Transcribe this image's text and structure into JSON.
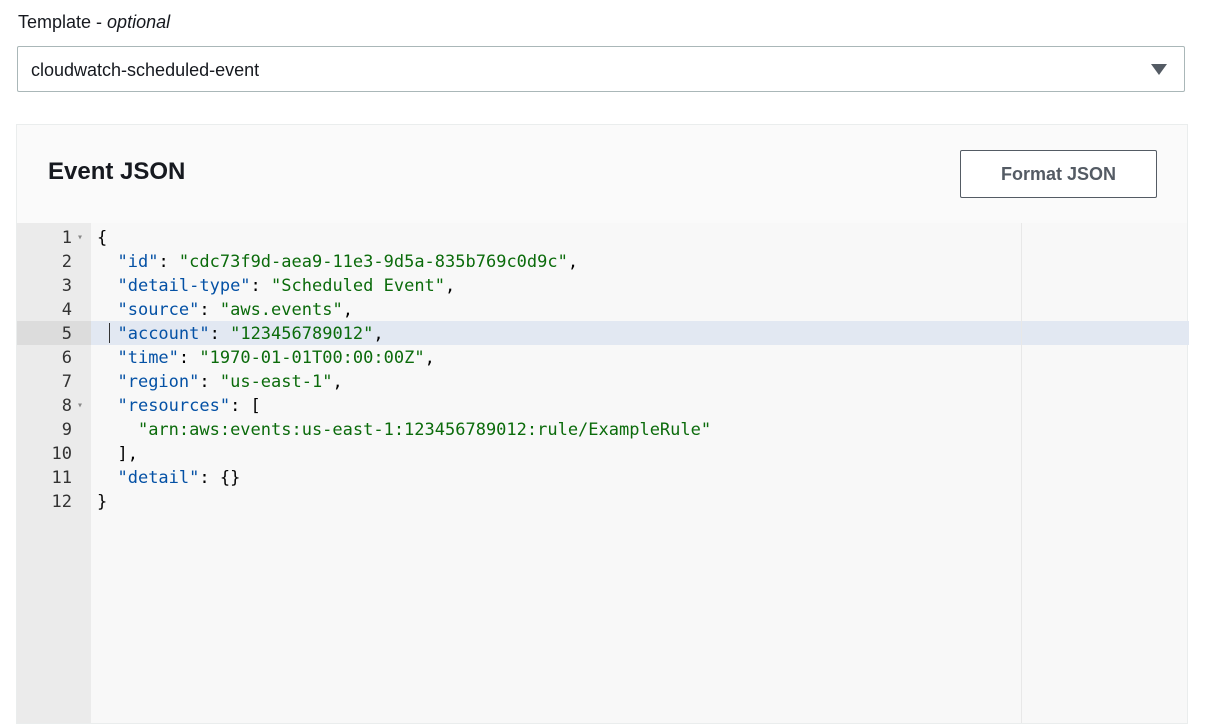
{
  "template": {
    "label": "Template - ",
    "label_optional": "optional",
    "selected": "cloudwatch-scheduled-event"
  },
  "panel": {
    "title": "Event JSON",
    "format_button": "Format JSON"
  },
  "editor": {
    "active_line": 5,
    "lines": [
      {
        "n": "1",
        "fold": true,
        "parts": [
          [
            "p",
            "{"
          ]
        ]
      },
      {
        "n": "2",
        "parts": [
          [
            "p",
            "  "
          ],
          [
            "k",
            "\"id\""
          ],
          [
            "p",
            ": "
          ],
          [
            "s",
            "\"cdc73f9d-aea9-11e3-9d5a-835b769c0d9c\""
          ],
          [
            "p",
            ","
          ]
        ]
      },
      {
        "n": "3",
        "parts": [
          [
            "p",
            "  "
          ],
          [
            "k",
            "\"detail-type\""
          ],
          [
            "p",
            ": "
          ],
          [
            "s",
            "\"Scheduled Event\""
          ],
          [
            "p",
            ","
          ]
        ]
      },
      {
        "n": "4",
        "parts": [
          [
            "p",
            "  "
          ],
          [
            "k",
            "\"source\""
          ],
          [
            "p",
            ": "
          ],
          [
            "s",
            "\"aws.events\""
          ],
          [
            "p",
            ","
          ]
        ]
      },
      {
        "n": "5",
        "parts": [
          [
            "p",
            "  "
          ],
          [
            "k",
            "\"account\""
          ],
          [
            "p",
            ": "
          ],
          [
            "s",
            "\"123456789012\""
          ],
          [
            "p",
            ","
          ]
        ]
      },
      {
        "n": "6",
        "parts": [
          [
            "p",
            "  "
          ],
          [
            "k",
            "\"time\""
          ],
          [
            "p",
            ": "
          ],
          [
            "s",
            "\"1970-01-01T00:00:00Z\""
          ],
          [
            "p",
            ","
          ]
        ]
      },
      {
        "n": "7",
        "parts": [
          [
            "p",
            "  "
          ],
          [
            "k",
            "\"region\""
          ],
          [
            "p",
            ": "
          ],
          [
            "s",
            "\"us-east-1\""
          ],
          [
            "p",
            ","
          ]
        ]
      },
      {
        "n": "8",
        "fold": true,
        "parts": [
          [
            "p",
            "  "
          ],
          [
            "k",
            "\"resources\""
          ],
          [
            "p",
            ": ["
          ]
        ]
      },
      {
        "n": "9",
        "parts": [
          [
            "p",
            "    "
          ],
          [
            "s",
            "\"arn:aws:events:us-east-1:123456789012:rule/ExampleRule\""
          ]
        ]
      },
      {
        "n": "10",
        "parts": [
          [
            "p",
            "  ],"
          ]
        ]
      },
      {
        "n": "11",
        "parts": [
          [
            "p",
            "  "
          ],
          [
            "k",
            "\"detail\""
          ],
          [
            "p",
            ": {}"
          ]
        ]
      },
      {
        "n": "12",
        "parts": [
          [
            "p",
            "}"
          ]
        ]
      }
    ]
  },
  "colors": {
    "key": "#0451a5",
    "string": "#0b6b0b",
    "active_line_bg": "#e2e8f2"
  },
  "icons": {
    "select_caret": "triangle-down-icon",
    "fold_marker": "fold-arrow-icon"
  }
}
